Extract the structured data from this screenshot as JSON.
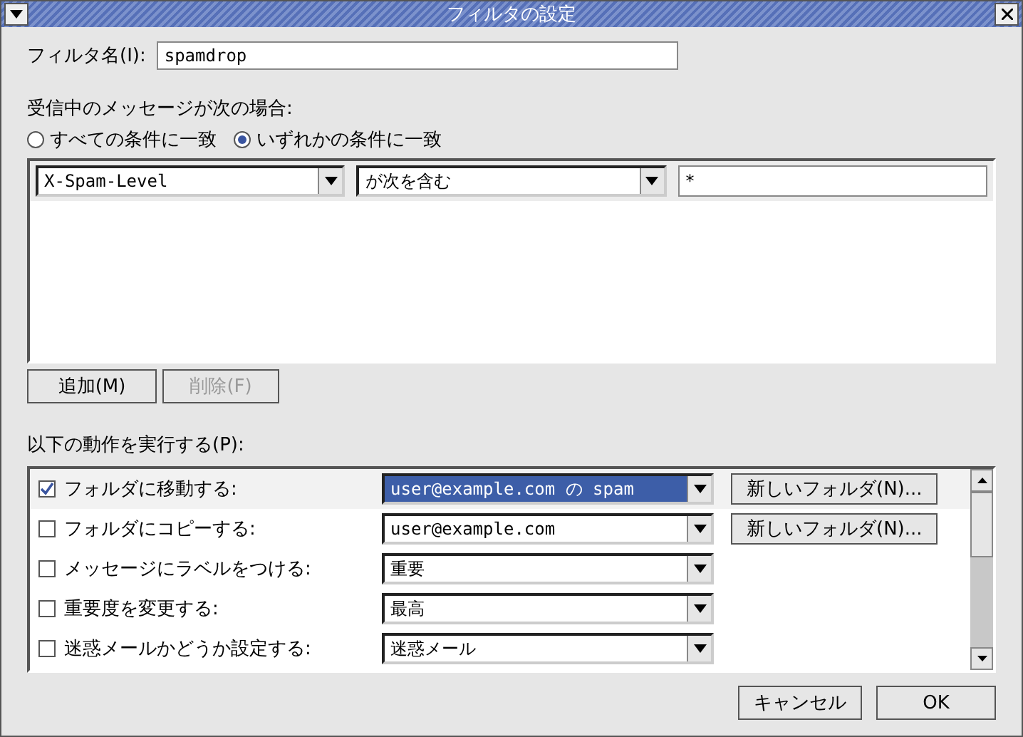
{
  "window": {
    "title": "フィルタの設定"
  },
  "filter_name": {
    "label": "フィルタ名(I):",
    "value": "spamdrop"
  },
  "match": {
    "label": "受信中のメッセージが次の場合:",
    "options": [
      {
        "label": "すべての条件に一致",
        "selected": false
      },
      {
        "label": "いずれかの条件に一致",
        "selected": true
      }
    ]
  },
  "conditions": [
    {
      "field": "X-Spam-Level",
      "operator": "が次を含む",
      "value": "*"
    }
  ],
  "condition_buttons": [
    {
      "label": "追加(M)",
      "disabled": false
    },
    {
      "label": "削除(F)",
      "disabled": true
    }
  ],
  "actions_label": "以下の動作を実行する(P):",
  "actions": [
    {
      "label": "フォルダに移動する:",
      "checked": true,
      "selected": true,
      "value": "user@example.com の spam",
      "button": "新しいフォルダ(N)..."
    },
    {
      "label": "フォルダにコピーする:",
      "checked": false,
      "selected": false,
      "value": "user@example.com",
      "button": "新しいフォルダ(N)..."
    },
    {
      "label": "メッセージにラベルをつける:",
      "checked": false,
      "selected": false,
      "value": "重要"
    },
    {
      "label": "重要度を変更する:",
      "checked": false,
      "selected": false,
      "value": "最高"
    },
    {
      "label": "迷惑メールかどうか設定する:",
      "checked": false,
      "selected": false,
      "value": "迷惑メール"
    }
  ],
  "buttons": [
    {
      "label": "キャンセル"
    },
    {
      "label": "OK"
    }
  ]
}
